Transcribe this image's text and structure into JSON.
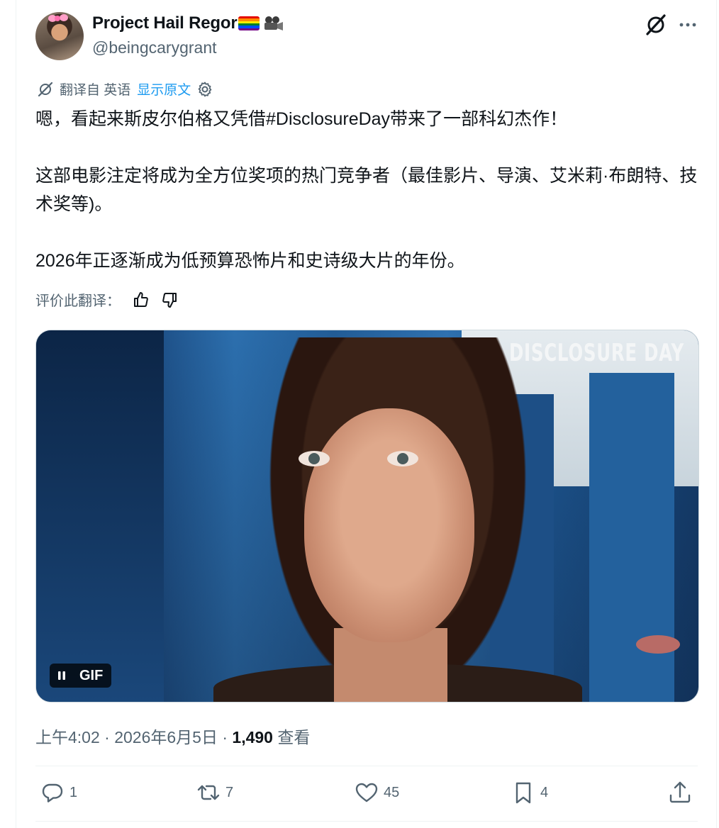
{
  "author": {
    "display_name": "Project Hail Regor",
    "handle": "@beingcarygrant",
    "name_emojis": [
      "rainbow-flag",
      "movie-camera"
    ]
  },
  "translation": {
    "translated_from": "翻译自 英语",
    "show_original": "显示原文"
  },
  "tweet": {
    "paragraphs": [
      "嗯，看起来斯皮尔伯格又凭借#DisclosureDay带来了一部科幻杰作！",
      "这部电影注定将成为全方位奖项的热门竞争者（最佳影片、导演、艾米莉·布朗特、技术奖等)。",
      "2026年正逐渐成为低预算恐怖片和史诗级大片的年份。"
    ]
  },
  "rating": {
    "label": "评价此翻译："
  },
  "media": {
    "overlay_text": "DISCLOSURE DAY",
    "badge": "GIF"
  },
  "meta": {
    "time": "上午4:02",
    "date": "2026年6月5日",
    "separator": " · ",
    "views_count": "1,490",
    "views_label": "查看"
  },
  "actions": {
    "replies": "1",
    "reposts": "7",
    "likes": "45",
    "bookmarks": "4"
  },
  "colors": {
    "accent": "#1d9bf0",
    "text": "#0f1419",
    "secondary": "#536471"
  }
}
